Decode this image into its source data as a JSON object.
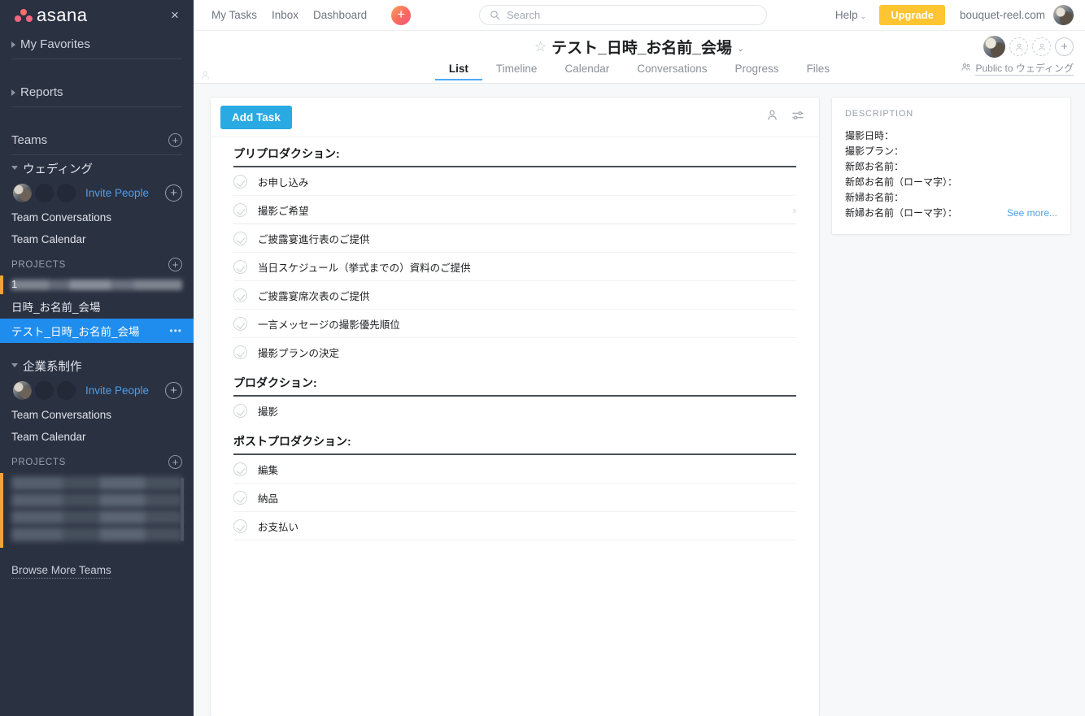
{
  "sidebar": {
    "logo_text": "asana",
    "close_icon": "×",
    "sections": [
      {
        "label": "My Favorites"
      },
      {
        "label": "Reports"
      },
      {
        "label": "Teams"
      }
    ],
    "teams": [
      {
        "name": "ウェディング",
        "invite_label": "Invite People",
        "links": [
          "Team Conversations",
          "Team Calendar"
        ],
        "projects_label": "PROJECTS",
        "projects": [
          {
            "label": "1",
            "redacted": true,
            "selected": false,
            "accent": "#f2a33c"
          },
          {
            "label": "日時_お名前_会場",
            "redacted": false,
            "selected": false
          },
          {
            "label": "テスト_日時_お名前_会場",
            "redacted": false,
            "selected": true,
            "menu": "•••"
          }
        ]
      },
      {
        "name": "企業系制作",
        "invite_label": "Invite People",
        "links": [
          "Team Conversations",
          "Team Calendar"
        ],
        "projects_label": "PROJECTS",
        "projects": [
          {
            "label": "",
            "redacted": true,
            "selected": false,
            "accent": "#f2a33c"
          },
          {
            "label": "",
            "redacted": true,
            "selected": false
          },
          {
            "label": "",
            "redacted": true,
            "selected": false
          },
          {
            "label": "",
            "redacted": true,
            "selected": false
          }
        ]
      }
    ],
    "browse_more": "Browse More Teams"
  },
  "topbar": {
    "nav": [
      "My Tasks",
      "Inbox",
      "Dashboard"
    ],
    "quick_add": "+",
    "search": {
      "placeholder": "Search",
      "value": ""
    },
    "help": "Help",
    "help_chevron": "⌄",
    "upgrade": "Upgrade",
    "domain": "bouquet-reel.com"
  },
  "project": {
    "star_icon": "☆",
    "title": "テスト_日時_お名前_会場",
    "title_chevron": "⌄",
    "tabs": [
      {
        "label": "List",
        "active": true
      },
      {
        "label": "Timeline",
        "active": false
      },
      {
        "label": "Calendar",
        "active": false
      },
      {
        "label": "Conversations",
        "active": false
      },
      {
        "label": "Progress",
        "active": false
      },
      {
        "label": "Files",
        "active": false
      }
    ],
    "privacy_label": "Public to ウェディング",
    "member_add": "+"
  },
  "list": {
    "add_task_label": "Add Task",
    "sections": [
      {
        "heading": "プリプロダクション:",
        "tasks": [
          {
            "name": "お申し込み",
            "chevron": ""
          },
          {
            "name": "撮影ご希望",
            "chevron": "›"
          },
          {
            "name": "ご披露宴進行表のご提供",
            "chevron": ""
          },
          {
            "name": "当日スケジュール（挙式までの）資料のご提供",
            "chevron": ""
          },
          {
            "name": "ご披露宴席次表のご提供",
            "chevron": ""
          },
          {
            "name": "一言メッセージの撮影優先順位",
            "chevron": ""
          },
          {
            "name": "撮影プランの決定",
            "chevron": ""
          }
        ]
      },
      {
        "heading": "プロダクション:",
        "tasks": [
          {
            "name": "撮影",
            "chevron": ""
          }
        ]
      },
      {
        "heading": "ポストプロダクション:",
        "tasks": [
          {
            "name": "編集",
            "chevron": ""
          },
          {
            "name": "納品",
            "chevron": ""
          },
          {
            "name": "お支払い",
            "chevron": ""
          }
        ]
      }
    ]
  },
  "description": {
    "title": "DESCRIPTION",
    "lines": [
      "撮影日時：",
      "撮影プラン：",
      "新郎お名前：",
      "新郎お名前（ローマ字）：",
      "新婦お名前：",
      "新婦お名前（ローマ字）："
    ],
    "see_more": "See more..."
  },
  "colors": {
    "sidebar_bg": "#2a3141",
    "selected_project": "#1f8ded",
    "add_task_blue": "#29aae3",
    "upgrade_yellow": "#ffc432",
    "tab_underline": "#4ba9f5",
    "link_blue": "#4e9ee8",
    "accent_orange": "#f2a33c"
  }
}
